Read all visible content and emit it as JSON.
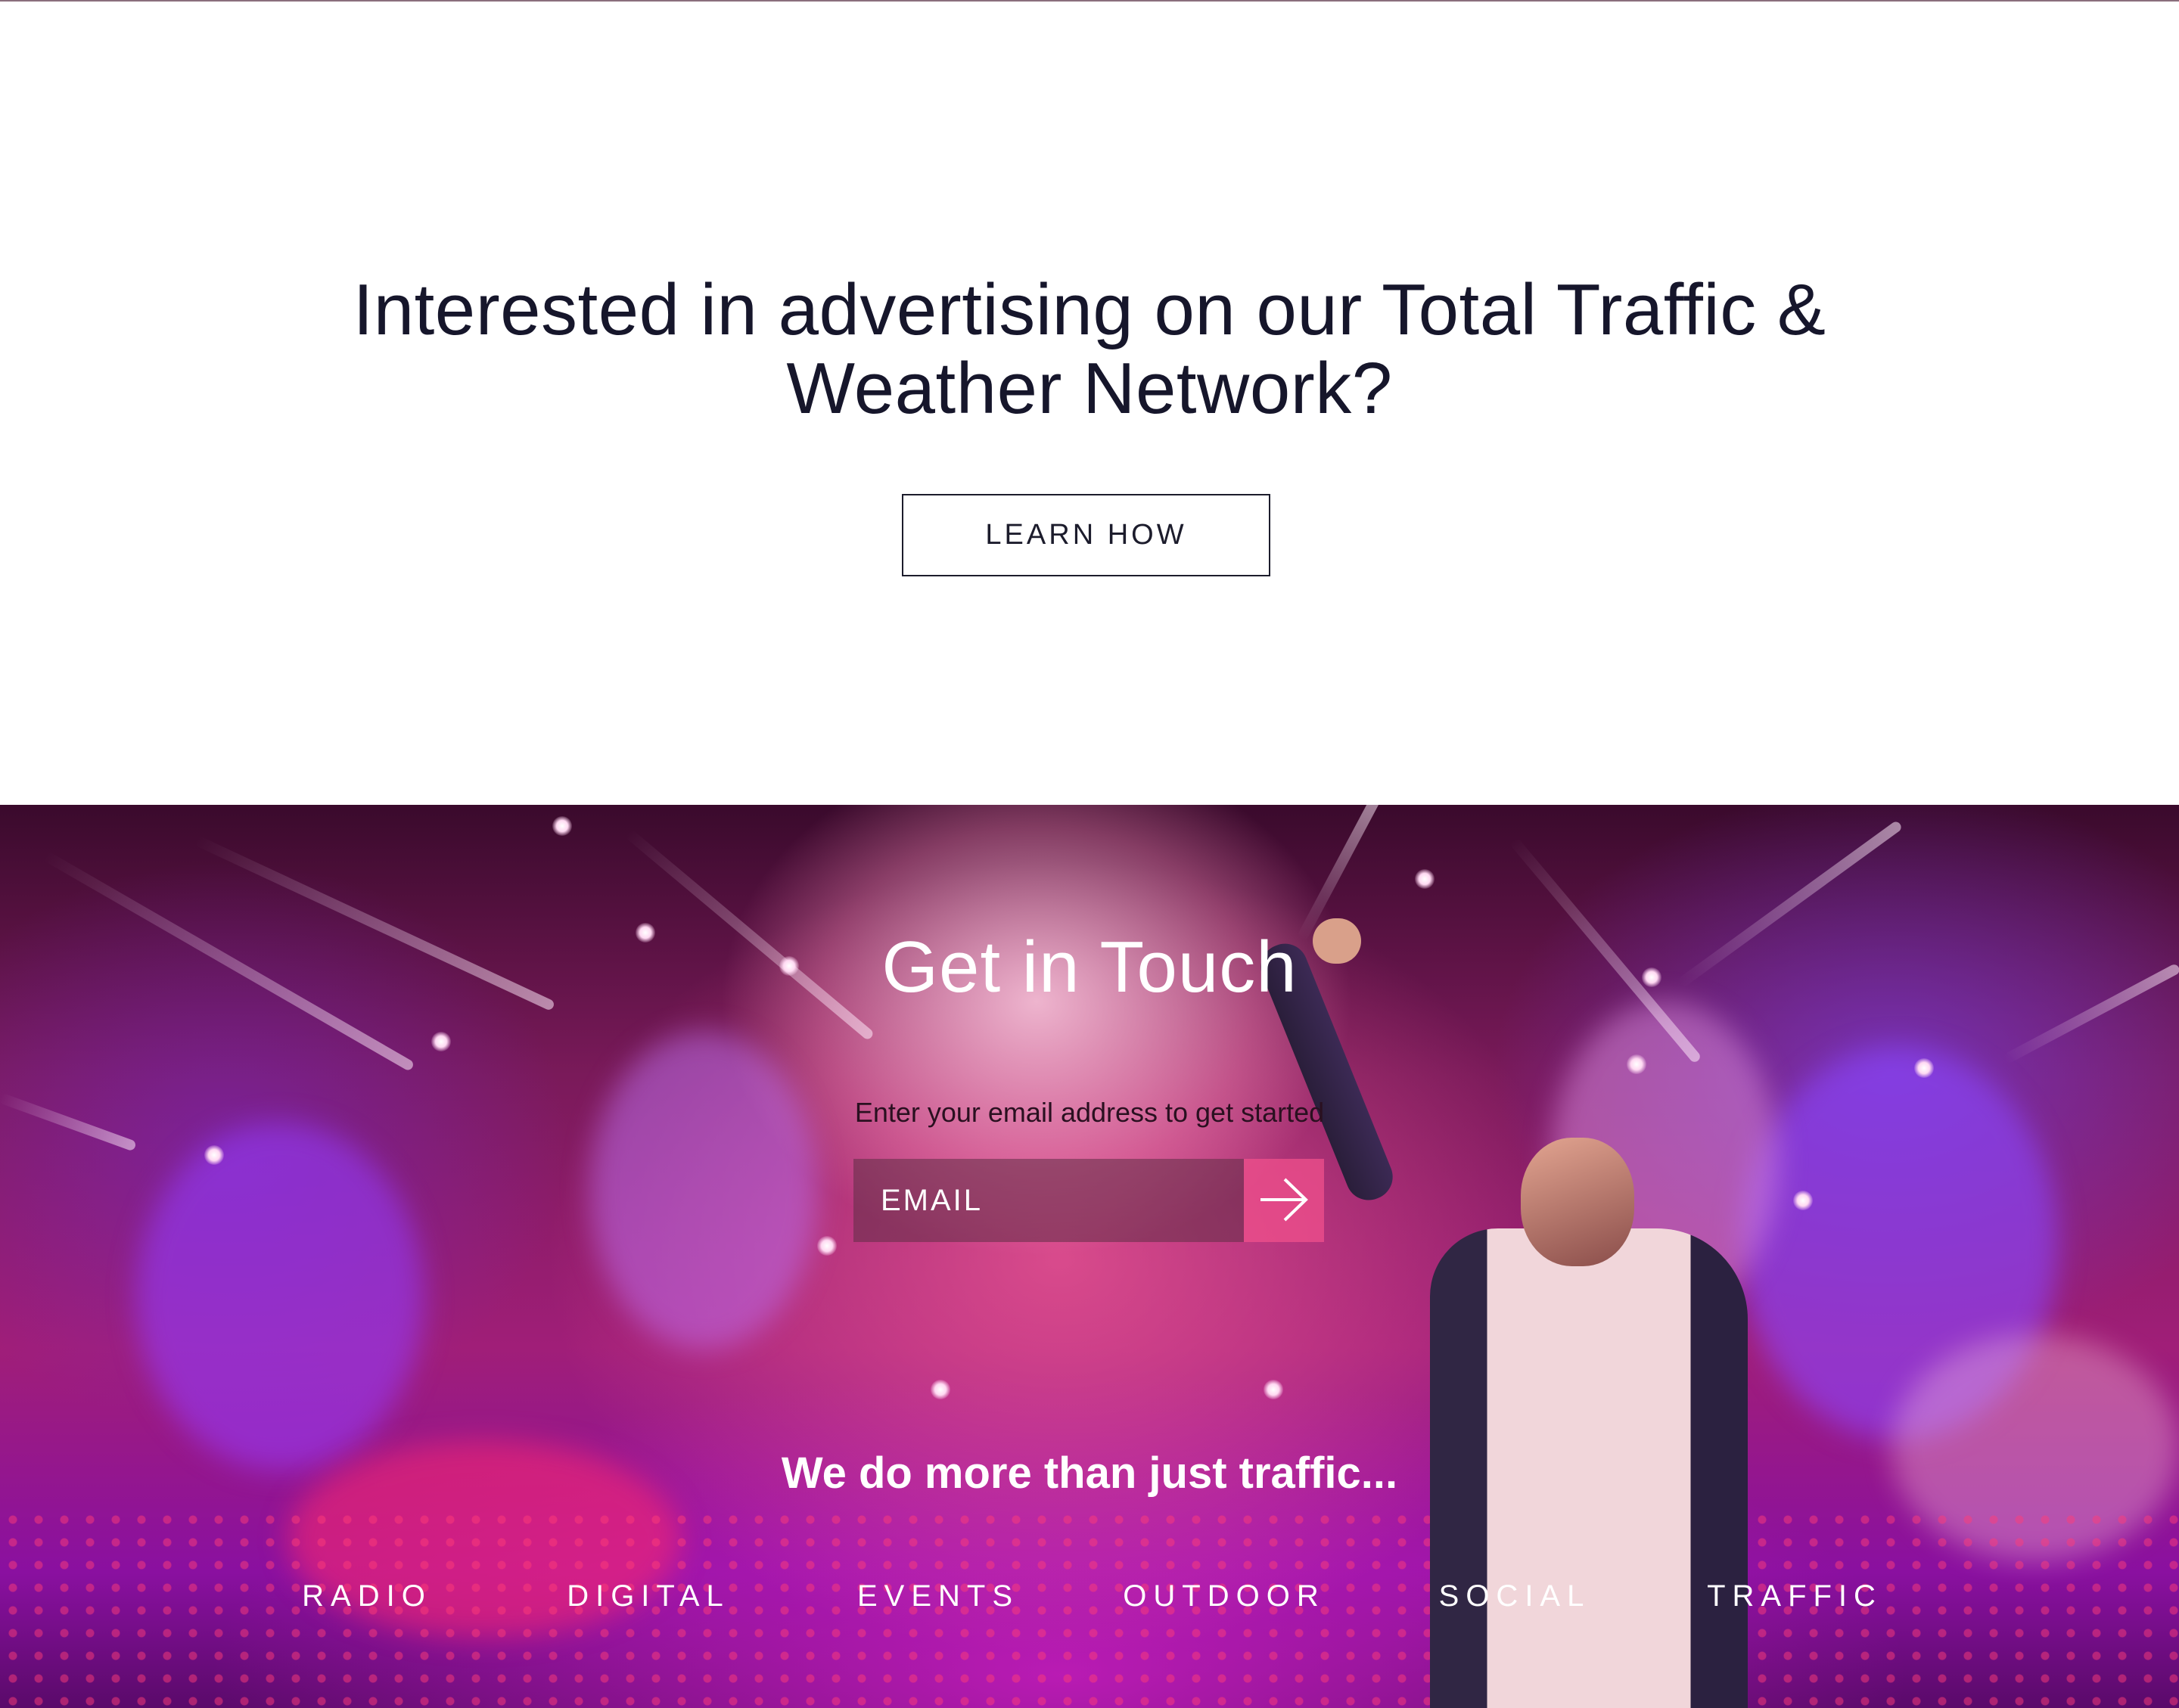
{
  "advertising": {
    "title_line1": "Interested in advertising on our Total Traffic &",
    "title_line2": "Weather Network?",
    "button_label": "LEARN HOW"
  },
  "contact": {
    "title": "Get in Touch",
    "subtitle": "Enter your email address to get started",
    "email_placeholder": "EMAIL",
    "submit_icon": "arrow-right-icon"
  },
  "services": {
    "heading": "We do more than just traffic...",
    "items": [
      {
        "label": "RADIO"
      },
      {
        "label": "DIGITAL"
      },
      {
        "label": "EVENTS"
      },
      {
        "label": "OUTDOOR"
      },
      {
        "label": "SOCIAL"
      },
      {
        "label": "TRAFFIC"
      }
    ]
  },
  "colors": {
    "heading_text": "#16162b",
    "button_border": "#1c1c2c",
    "submit_accent": "#f0508c",
    "background_image": "concert-stage-lights"
  }
}
